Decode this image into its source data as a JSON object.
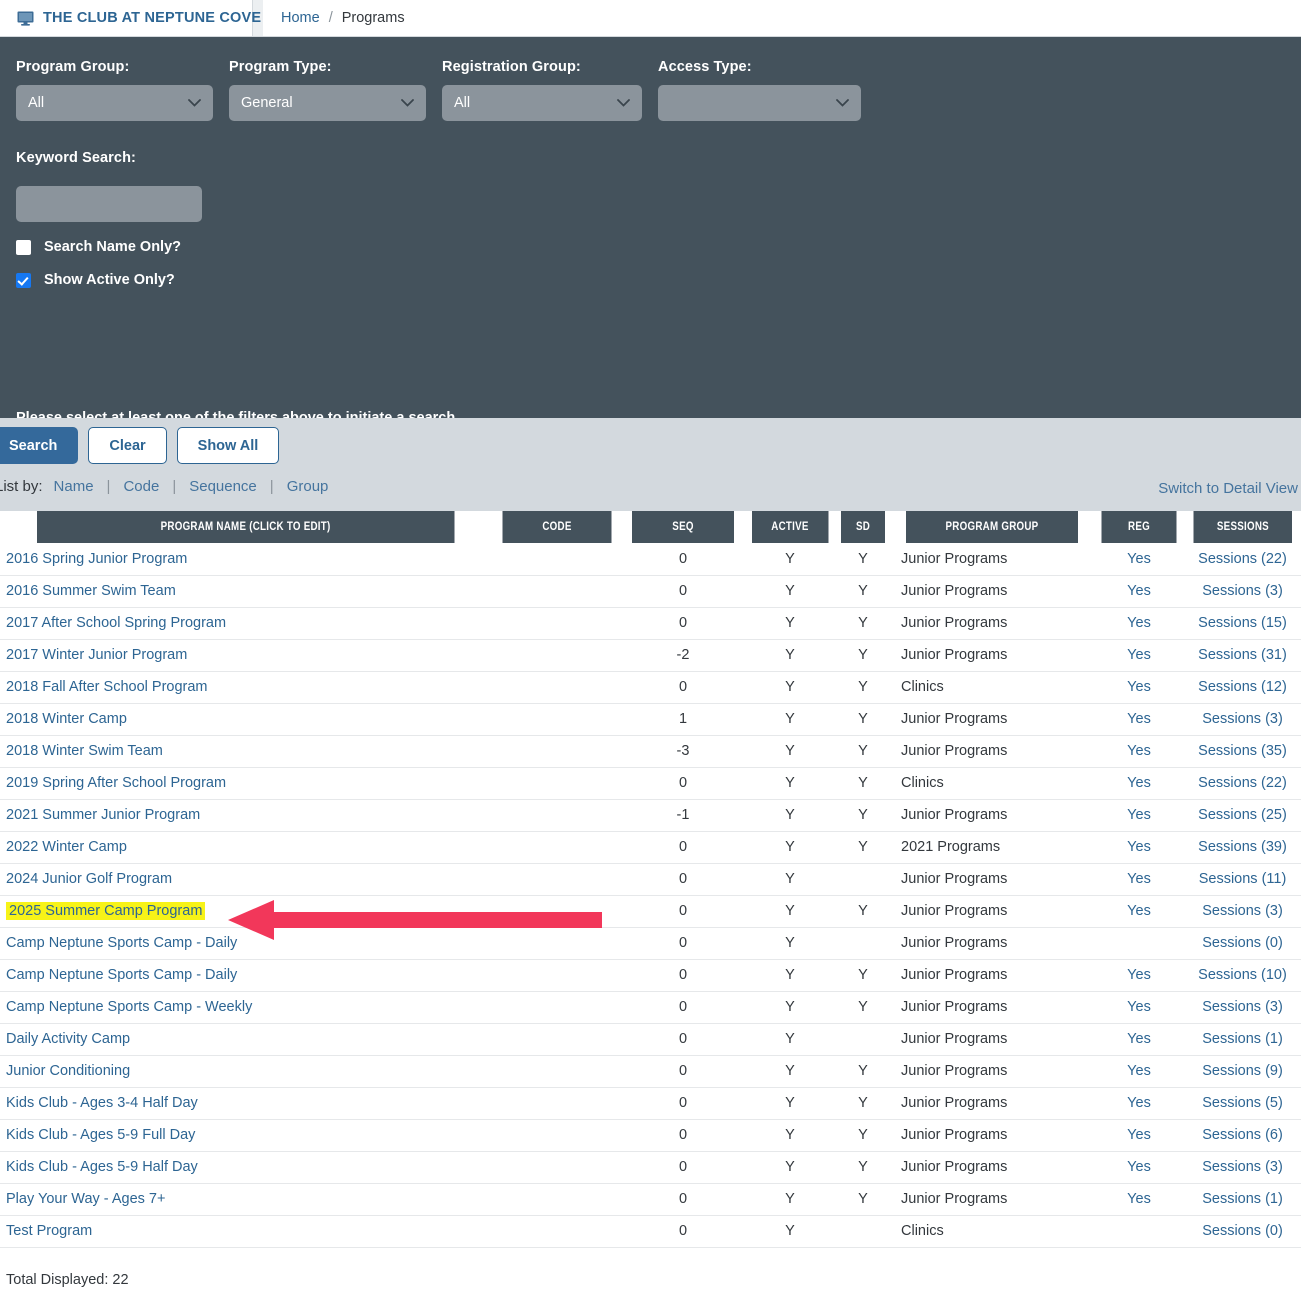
{
  "header": {
    "brand": "THE CLUB AT NEPTUNE COVE",
    "brand_icon": "monitor-icon",
    "breadcrumb": {
      "home": "Home",
      "separator": "/",
      "current": "Programs"
    }
  },
  "filters": {
    "program_group": {
      "label": "Program Group:",
      "value": "All"
    },
    "program_type": {
      "label": "Program Type:",
      "value": "General"
    },
    "registration_group": {
      "label": "Registration Group:",
      "value": "All"
    },
    "access_type": {
      "label": "Access Type:",
      "value": ""
    },
    "keyword_search": {
      "label": "Keyword Search:",
      "value": "",
      "placeholder": ""
    },
    "search_name_only": {
      "label": "Search Name Only?",
      "checked": false
    },
    "show_active_only": {
      "label": "Show Active Only?",
      "checked": true
    },
    "hint": "Please select at least one of the filters above to initiate a search."
  },
  "actions": {
    "search_label": "Search",
    "clear_label": "Clear",
    "show_all_label": "Show All"
  },
  "list_by": {
    "label": "List by:",
    "options": [
      "Name",
      "Code",
      "Sequence",
      "Group"
    ],
    "separator": "|"
  },
  "detail_view_link": "Switch to Detail View",
  "table": {
    "columns": [
      "PROGRAM NAME (CLICK TO EDIT)",
      "CODE",
      "SEQ",
      "ACTIVE",
      "SD",
      "PROGRAM GROUP",
      "REG",
      "SESSIONS"
    ],
    "rows": [
      {
        "name": "2016 Spring Junior Program",
        "code": "",
        "seq": "0",
        "active": "Y",
        "sd": "Y",
        "group": "Junior Programs",
        "reg": "Yes",
        "sessions": "Sessions (22)",
        "highlight": false
      },
      {
        "name": "2016 Summer Swim Team",
        "code": "",
        "seq": "0",
        "active": "Y",
        "sd": "Y",
        "group": "Junior Programs",
        "reg": "Yes",
        "sessions": "Sessions (3)",
        "highlight": false
      },
      {
        "name": "2017 After School Spring Program",
        "code": "",
        "seq": "0",
        "active": "Y",
        "sd": "Y",
        "group": "Junior Programs",
        "reg": "Yes",
        "sessions": "Sessions (15)",
        "highlight": false
      },
      {
        "name": "2017 Winter Junior Program",
        "code": "",
        "seq": "-2",
        "active": "Y",
        "sd": "Y",
        "group": "Junior Programs",
        "reg": "Yes",
        "sessions": "Sessions (31)",
        "highlight": false
      },
      {
        "name": "2018 Fall After School Program",
        "code": "",
        "seq": "0",
        "active": "Y",
        "sd": "Y",
        "group": "Clinics",
        "reg": "Yes",
        "sessions": "Sessions (12)",
        "highlight": false
      },
      {
        "name": "2018 Winter Camp",
        "code": "",
        "seq": "1",
        "active": "Y",
        "sd": "Y",
        "group": "Junior Programs",
        "reg": "Yes",
        "sessions": "Sessions (3)",
        "highlight": false
      },
      {
        "name": "2018 Winter Swim Team",
        "code": "",
        "seq": "-3",
        "active": "Y",
        "sd": "Y",
        "group": "Junior Programs",
        "reg": "Yes",
        "sessions": "Sessions (35)",
        "highlight": false
      },
      {
        "name": "2019 Spring After School Program",
        "code": "",
        "seq": "0",
        "active": "Y",
        "sd": "Y",
        "group": "Clinics",
        "reg": "Yes",
        "sessions": "Sessions (22)",
        "highlight": false
      },
      {
        "name": "2021 Summer Junior Program",
        "code": "",
        "seq": "-1",
        "active": "Y",
        "sd": "Y",
        "group": "Junior Programs",
        "reg": "Yes",
        "sessions": "Sessions (25)",
        "highlight": false
      },
      {
        "name": "2022 Winter Camp",
        "code": "",
        "seq": "0",
        "active": "Y",
        "sd": "Y",
        "group": "2021 Programs",
        "reg": "Yes",
        "sessions": "Sessions (39)",
        "highlight": false
      },
      {
        "name": "2024 Junior Golf Program",
        "code": "",
        "seq": "0",
        "active": "Y",
        "sd": "",
        "group": "Junior Programs",
        "reg": "Yes",
        "sessions": "Sessions (11)",
        "highlight": false
      },
      {
        "name": "2025 Summer Camp Program",
        "code": "",
        "seq": "0",
        "active": "Y",
        "sd": "Y",
        "group": "Junior Programs",
        "reg": "Yes",
        "sessions": "Sessions (3)",
        "highlight": true
      },
      {
        "name": "Camp Neptune Sports Camp - Daily",
        "code": "",
        "seq": "0",
        "active": "Y",
        "sd": "",
        "group": "Junior Programs",
        "reg": "",
        "sessions": "Sessions (0)",
        "highlight": false
      },
      {
        "name": "Camp Neptune Sports Camp - Daily",
        "code": "",
        "seq": "0",
        "active": "Y",
        "sd": "Y",
        "group": "Junior Programs",
        "reg": "Yes",
        "sessions": "Sessions (10)",
        "highlight": false
      },
      {
        "name": "Camp Neptune Sports Camp - Weekly",
        "code": "",
        "seq": "0",
        "active": "Y",
        "sd": "Y",
        "group": "Junior Programs",
        "reg": "Yes",
        "sessions": "Sessions (3)",
        "highlight": false
      },
      {
        "name": "Daily Activity Camp",
        "code": "",
        "seq": "0",
        "active": "Y",
        "sd": "",
        "group": "Junior Programs",
        "reg": "Yes",
        "sessions": "Sessions (1)",
        "highlight": false
      },
      {
        "name": "Junior Conditioning",
        "code": "",
        "seq": "0",
        "active": "Y",
        "sd": "Y",
        "group": "Junior Programs",
        "reg": "Yes",
        "sessions": "Sessions (9)",
        "highlight": false
      },
      {
        "name": "Kids Club - Ages 3-4 Half Day",
        "code": "",
        "seq": "0",
        "active": "Y",
        "sd": "Y",
        "group": "Junior Programs",
        "reg": "Yes",
        "sessions": "Sessions (5)",
        "highlight": false
      },
      {
        "name": "Kids Club - Ages 5-9 Full Day",
        "code": "",
        "seq": "0",
        "active": "Y",
        "sd": "Y",
        "group": "Junior Programs",
        "reg": "Yes",
        "sessions": "Sessions (6)",
        "highlight": false
      },
      {
        "name": "Kids Club - Ages 5-9 Half Day",
        "code": "",
        "seq": "0",
        "active": "Y",
        "sd": "Y",
        "group": "Junior Programs",
        "reg": "Yes",
        "sessions": "Sessions (3)",
        "highlight": false
      },
      {
        "name": "Play Your Way - Ages 7+",
        "code": "",
        "seq": "0",
        "active": "Y",
        "sd": "Y",
        "group": "Junior Programs",
        "reg": "Yes",
        "sessions": "Sessions (1)",
        "highlight": false
      },
      {
        "name": "Test Program",
        "code": "",
        "seq": "0",
        "active": "Y",
        "sd": "",
        "group": "Clinics",
        "reg": "",
        "sessions": "Sessions (0)",
        "highlight": false
      }
    ]
  },
  "footer": {
    "total_displayed": "Total Displayed: 22"
  },
  "annotation": {
    "arrow_color": "#f2375a",
    "direction": "left",
    "highlight_color": "#f7f318"
  },
  "colors": {
    "panel_bg": "#44525c",
    "accent_blue": "#2d6593",
    "button_primary": "#34699b",
    "action_bar": "#d3d9de",
    "field_bg": "#8b949c"
  }
}
